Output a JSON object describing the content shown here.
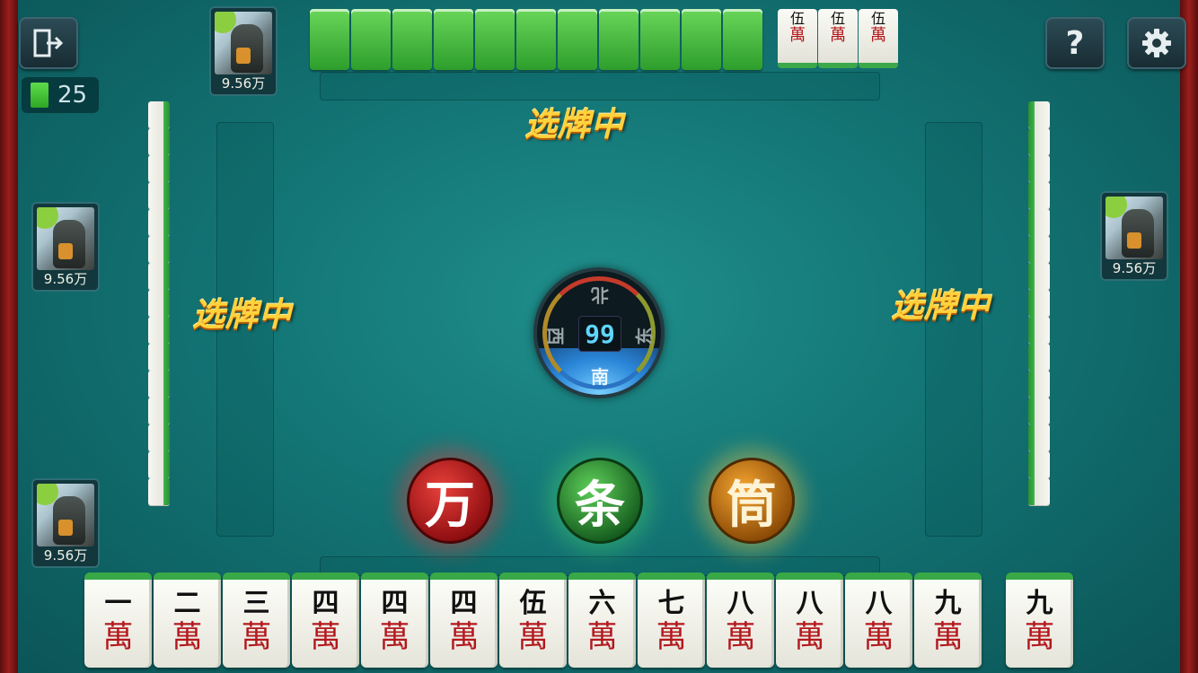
{
  "hud": {
    "exit_icon": "exit-door-icon",
    "help_icon": "question-mark-icon",
    "settings_icon": "gear-icon",
    "remaining_tiles": "25"
  },
  "players": {
    "top": {
      "money": "9.56万"
    },
    "left_upper": {
      "money": "9.56万"
    },
    "left_lower": {
      "money": "9.56万"
    },
    "right": {
      "money": "9.56万"
    }
  },
  "status": {
    "top": "选牌中",
    "left": "选牌中",
    "right": "选牌中"
  },
  "top_open_tiles": [
    {
      "num": "伍",
      "suit": "萬"
    },
    {
      "num": "伍",
      "suit": "萬"
    },
    {
      "num": "伍",
      "suit": "萬"
    }
  ],
  "compass": {
    "timer": "99",
    "north": "北",
    "west": "西",
    "east": "东",
    "south": "南",
    "active": "south"
  },
  "suit_choices": {
    "wan": "万",
    "tiao": "条",
    "tong": "筒"
  },
  "hand": [
    {
      "num": "一",
      "suit": "萬"
    },
    {
      "num": "二",
      "suit": "萬"
    },
    {
      "num": "三",
      "suit": "萬"
    },
    {
      "num": "四",
      "suit": "萬"
    },
    {
      "num": "四",
      "suit": "萬"
    },
    {
      "num": "四",
      "suit": "萬"
    },
    {
      "num": "伍",
      "suit": "萬"
    },
    {
      "num": "六",
      "suit": "萬"
    },
    {
      "num": "七",
      "suit": "萬"
    },
    {
      "num": "八",
      "suit": "萬"
    },
    {
      "num": "八",
      "suit": "萬"
    },
    {
      "num": "八",
      "suit": "萬"
    },
    {
      "num": "九",
      "suit": "萬"
    },
    {
      "num": "九",
      "suit": "萬"
    }
  ],
  "colors": {
    "felt": "#137474",
    "tile_back": "#3cb54a",
    "status_text": "#ffd23b",
    "wan_button": "#c21d1d",
    "tiao_button": "#2f9a35",
    "tong_button": "#d9861a"
  }
}
